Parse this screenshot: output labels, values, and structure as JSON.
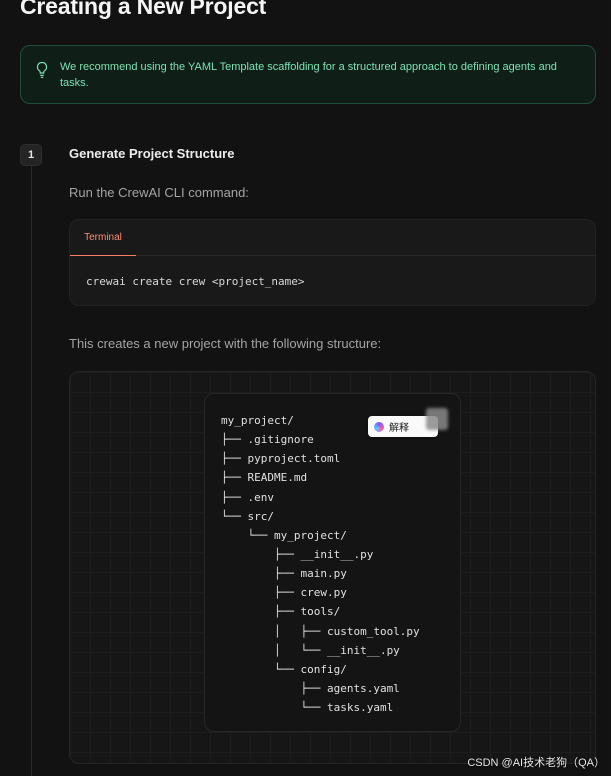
{
  "page": {
    "title": "Creating a New Project"
  },
  "callout": {
    "icon": "lightbulb-icon",
    "text": "We recommend using the YAML Template scaffolding for a structured approach to defining agents and tasks.",
    "accent_color": "#7ee2b4"
  },
  "step": {
    "number": "1",
    "title": "Generate Project Structure",
    "intro": "Run the CrewAI CLI command:",
    "terminal": {
      "tab_label": "Terminal",
      "command": "crewai create crew <project_name>"
    },
    "structure_intro": "This creates a new project with the following structure:",
    "tree": [
      "my_project/",
      "├── .gitignore",
      "├── pyproject.toml",
      "├── README.md",
      "├── .env",
      "└── src/",
      "    └── my_project/",
      "        ├── __init__.py",
      "        ├── main.py",
      "        ├── crew.py",
      "        ├── tools/",
      "        │   ├── custom_tool.py",
      "        │   └── __init__.py",
      "        └── config/",
      "            ├── agents.yaml",
      "            └── tasks.yaml"
    ]
  },
  "overlay": {
    "translate_label": "解释",
    "translate_icon": "ai-translate-icon"
  },
  "watermark": "CSDN @AI技术老狗（QA）"
}
